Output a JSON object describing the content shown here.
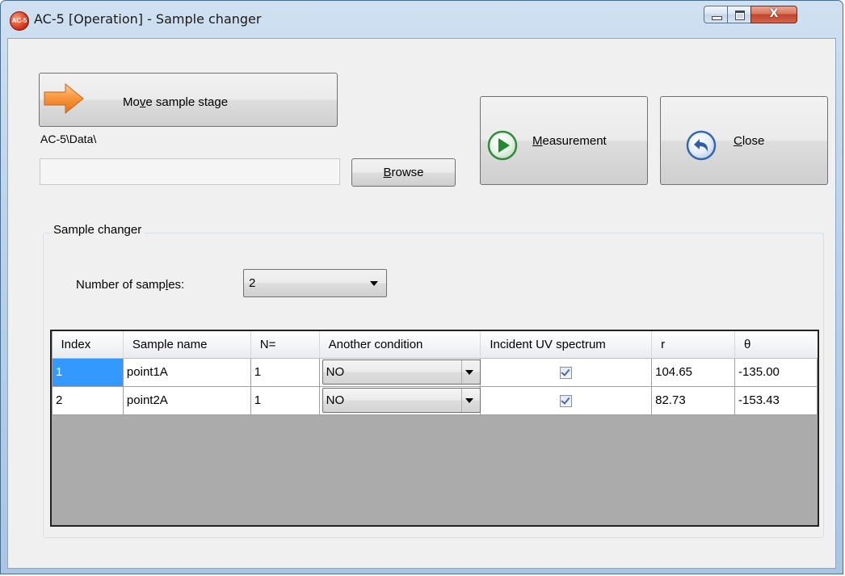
{
  "window": {
    "title": "AC-5 [Operation] - Sample changer",
    "app_icon_text": "AC-5",
    "close_glyph": "X"
  },
  "toolbar": {
    "move_stage_label_pre": "Mo",
    "move_stage_label_mnemonic": "v",
    "move_stage_label_post": "e sample stage",
    "data_path": "AC-5\\Data\\",
    "path_input_value": "",
    "browse_mnemonic": "B",
    "browse_rest": "rowse",
    "measurement_mnemonic": "M",
    "measurement_rest": "easurement",
    "close_mnemonic": "C",
    "close_rest": "lose"
  },
  "sample_changer": {
    "group_title": "Sample changer",
    "num_samples_label_pre": "Number of samp",
    "num_samples_label_mnemonic": "l",
    "num_samples_label_post": "es:",
    "num_samples_value": "2",
    "columns": [
      "Index",
      "Sample name",
      "N=",
      "Another condition",
      "Incident UV spectrum",
      "r",
      "θ"
    ],
    "rows": [
      {
        "index": "1",
        "name": "point1A",
        "n": "1",
        "condition": "NO",
        "uv_checked": true,
        "r": "104.65",
        "theta": "-135.00"
      },
      {
        "index": "2",
        "name": "point2A",
        "n": "1",
        "condition": "NO",
        "uv_checked": true,
        "r": "82.73",
        "theta": "-153.43"
      }
    ]
  },
  "colors": {
    "selection": "#3399ff",
    "grid_empty": "#ababab",
    "window_frame": "#b9d1ea"
  },
  "icons": {
    "move": "orange-arrow-icon",
    "measurement": "play-icon",
    "close": "back-arrow-icon"
  }
}
